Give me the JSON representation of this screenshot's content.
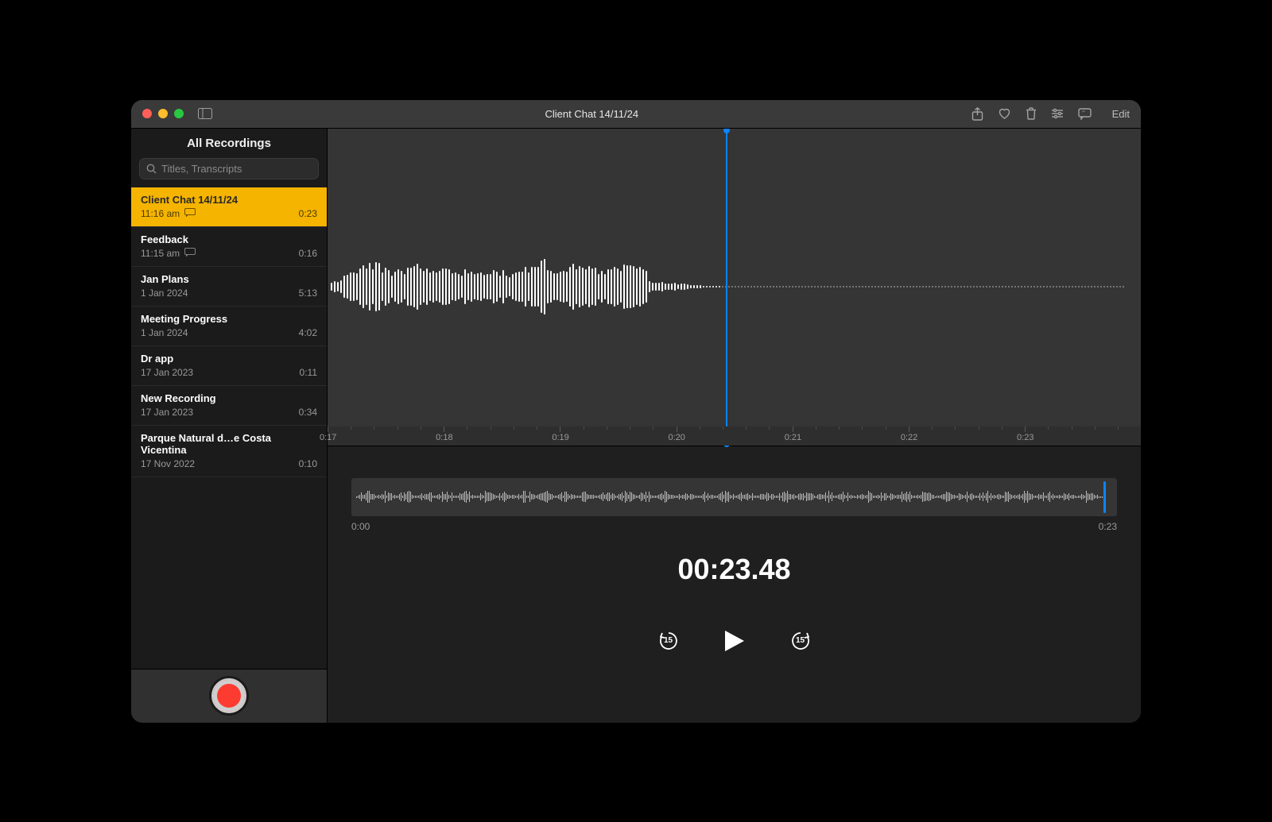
{
  "window": {
    "title": "Client Chat 14/11/24"
  },
  "toolbar": {
    "edit_label": "Edit"
  },
  "sidebar": {
    "header": "All Recordings",
    "search_placeholder": "Titles, Transcripts",
    "items": [
      {
        "title": "Client Chat 14/11/24",
        "subtitle": "11:16 am",
        "duration": "0:23",
        "has_transcript": true,
        "selected": true
      },
      {
        "title": "Feedback",
        "subtitle": "11:15 am",
        "duration": "0:16",
        "has_transcript": true,
        "selected": false
      },
      {
        "title": "Jan Plans",
        "subtitle": "1 Jan 2024",
        "duration": "5:13",
        "has_transcript": false,
        "selected": false
      },
      {
        "title": "Meeting Progress",
        "subtitle": "1 Jan 2024",
        "duration": "4:02",
        "has_transcript": false,
        "selected": false
      },
      {
        "title": "Dr app",
        "subtitle": "17 Jan 2023",
        "duration": "0:11",
        "has_transcript": false,
        "selected": false
      },
      {
        "title": "New Recording",
        "subtitle": "17 Jan 2023",
        "duration": "0:34",
        "has_transcript": false,
        "selected": false
      },
      {
        "title": "Parque Natural d…e Costa Vicentina",
        "subtitle": "17 Nov 2022",
        "duration": "0:10",
        "has_transcript": false,
        "selected": false
      }
    ]
  },
  "player": {
    "ruler": [
      "0:17",
      "0:18",
      "0:19",
      "0:20",
      "0:21",
      "0:22",
      "0:23"
    ],
    "overview_start": "0:00",
    "overview_end": "0:23",
    "time": "00:23.48",
    "skip_seconds": "15",
    "playhead_fraction": 0.49,
    "overview_playhead_fraction": 0.985
  },
  "colors": {
    "accent_blue": "#0a84ff",
    "selection_yellow": "#f5b400",
    "record_red": "#fd3b31"
  }
}
